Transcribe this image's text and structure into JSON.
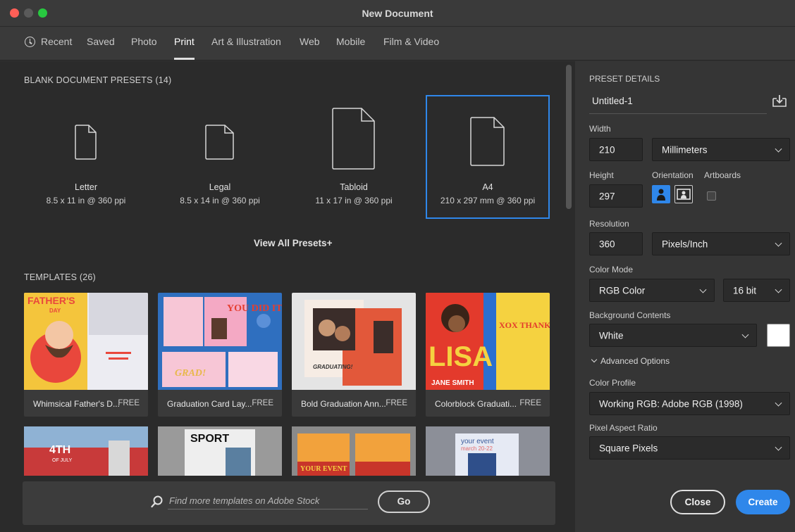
{
  "window": {
    "title": "New Document"
  },
  "tabs": [
    {
      "label": "Recent"
    },
    {
      "label": "Saved"
    },
    {
      "label": "Photo"
    },
    {
      "label": "Print",
      "active": true
    },
    {
      "label": "Art & Illustration"
    },
    {
      "label": "Web"
    },
    {
      "label": "Mobile"
    },
    {
      "label": "Film & Video"
    }
  ],
  "blank_presets": {
    "heading": "BLANK DOCUMENT PRESETS",
    "count": "(14)",
    "items": [
      {
        "name": "Letter",
        "size": "8.5 x 11 in @ 360 ppi"
      },
      {
        "name": "Legal",
        "size": "8.5 x 14 in @ 360 ppi"
      },
      {
        "name": "Tabloid",
        "size": "11 x 17 in @ 360 ppi"
      },
      {
        "name": "A4",
        "size": "210 x 297 mm @ 360 ppi",
        "selected": true
      }
    ],
    "view_all": "View All Presets",
    "view_all_plus": "+"
  },
  "templates": {
    "heading": "TEMPLATES",
    "count": "(26)",
    "items": [
      {
        "name": "Whimsical Father's D...",
        "badge": "FREE",
        "thumb_text": "FATHER'S",
        "thumb_text2": "DAY"
      },
      {
        "name": "Graduation Card Lay...",
        "badge": "FREE",
        "thumb_text": "YOU DID IT",
        "thumb_text2": "GRAD!"
      },
      {
        "name": "Bold Graduation Ann...",
        "badge": "FREE",
        "thumb_text": "GRADUATING!"
      },
      {
        "name": "Colorblock Graduati...",
        "badge": "FREE",
        "thumb_text": "LISA",
        "thumb_text2": "JANE SMITH",
        "thumb_text3": "XOX THANK YOU!"
      }
    ],
    "row2": [
      {
        "thumb_text": "4TH",
        "thumb_text2": "OF JULY"
      },
      {
        "thumb_text": "SPORT"
      },
      {
        "thumb_text": "YOUR EVENT"
      },
      {
        "thumb_text": "your event",
        "thumb_text2": "march 20-22"
      }
    ]
  },
  "stock": {
    "placeholder": "Find more templates on Adobe Stock",
    "go_label": "Go"
  },
  "details": {
    "heading": "PRESET DETAILS",
    "doc_name": "Untitled-1",
    "width_label": "Width",
    "width_value": "210",
    "width_unit": "Millimeters",
    "height_label": "Height",
    "height_value": "297",
    "orientation_label": "Orientation",
    "artboards_label": "Artboards",
    "resolution_label": "Resolution",
    "resolution_value": "360",
    "resolution_unit": "Pixels/Inch",
    "color_mode_label": "Color Mode",
    "color_mode_value": "RGB Color",
    "bit_depth": "16 bit",
    "background_label": "Background Contents",
    "background_value": "White",
    "advanced_label": "Advanced Options",
    "color_profile_label": "Color Profile",
    "color_profile_value": "Working RGB: Adobe RGB (1998)",
    "pixel_aspect_label": "Pixel Aspect Ratio",
    "pixel_aspect_value": "Square Pixels"
  },
  "buttons": {
    "close": "Close",
    "create": "Create"
  },
  "colors": {
    "accent": "#2f87ea",
    "panel": "#353535",
    "content": "#2b2b2b"
  }
}
